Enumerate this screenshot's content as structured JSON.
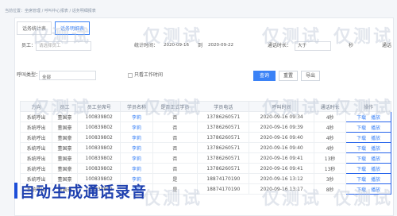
{
  "breadcrumb": "当前位置：坐席管理 / 呼叫中心报表 / 话务明细报表",
  "tabs": [
    {
      "label": "话务统计表",
      "active": false
    },
    {
      "label": "话务明细表",
      "active": true
    }
  ],
  "filters": {
    "agent_label": "员工：",
    "agent_placeholder": "请选择员工",
    "date_label": "统计时间：",
    "date_from": "2020-09-16",
    "date_to_label": "到",
    "date_to": "2020-09-22",
    "duration_label": "通话时长：",
    "duration_op": "大于",
    "duration_unit": "秒",
    "call_type_label": "通话",
    "group_label": "呼叫类型：",
    "group_value": "全部",
    "checkbox_label": "只看工作时间",
    "query_button": "查询",
    "reset_button": "重置",
    "export_button": "导出"
  },
  "table": {
    "headers": [
      "方向",
      "员工",
      "员工坐席号",
      "学员名称",
      "是否正式学员",
      "学员电话",
      "呼叫时间",
      "通话时长",
      "操作"
    ],
    "rows": [
      [
        "系统呼出",
        "董国豪",
        "100839802",
        "李莉",
        "否",
        "13786260571",
        "2020-09-16 09:34",
        "4秒"
      ],
      [
        "系统呼出",
        "董国豪",
        "100839802",
        "李莉",
        "否",
        "13786260571",
        "2020-09-16 09:39",
        "4秒"
      ],
      [
        "系统呼出",
        "董国豪",
        "100839802",
        "李莉",
        "否",
        "13786260571",
        "2020-09-16 09:40",
        "4秒"
      ],
      [
        "系统呼出",
        "董国豪",
        "100839802",
        "李莉",
        "否",
        "13786260571",
        "2020-09-16 09:40",
        "4秒"
      ],
      [
        "系统呼出",
        "董国豪",
        "100839802",
        "李莉",
        "否",
        "13786260571",
        "2020-09-16 09:41",
        "13秒"
      ],
      [
        "系统呼出",
        "董国豪",
        "100839802",
        "李莉",
        "否",
        "13786260571",
        "2020-09-16 09:41",
        "13秒"
      ],
      [
        "系统呼出",
        "董国豪",
        "100839802",
        "李莉",
        "是",
        "18874170190",
        "2020-09-16 13:12",
        "3秒"
      ],
      [
        "系统呼出",
        "董国豪",
        "100839802",
        "李莉",
        "是",
        "18874170190",
        "2020-09-16 13:17",
        "8秒"
      ]
    ],
    "op_download": "下载",
    "op_play": "播放"
  },
  "banner": "自动生成通话录音",
  "watermark": "仅测试"
}
